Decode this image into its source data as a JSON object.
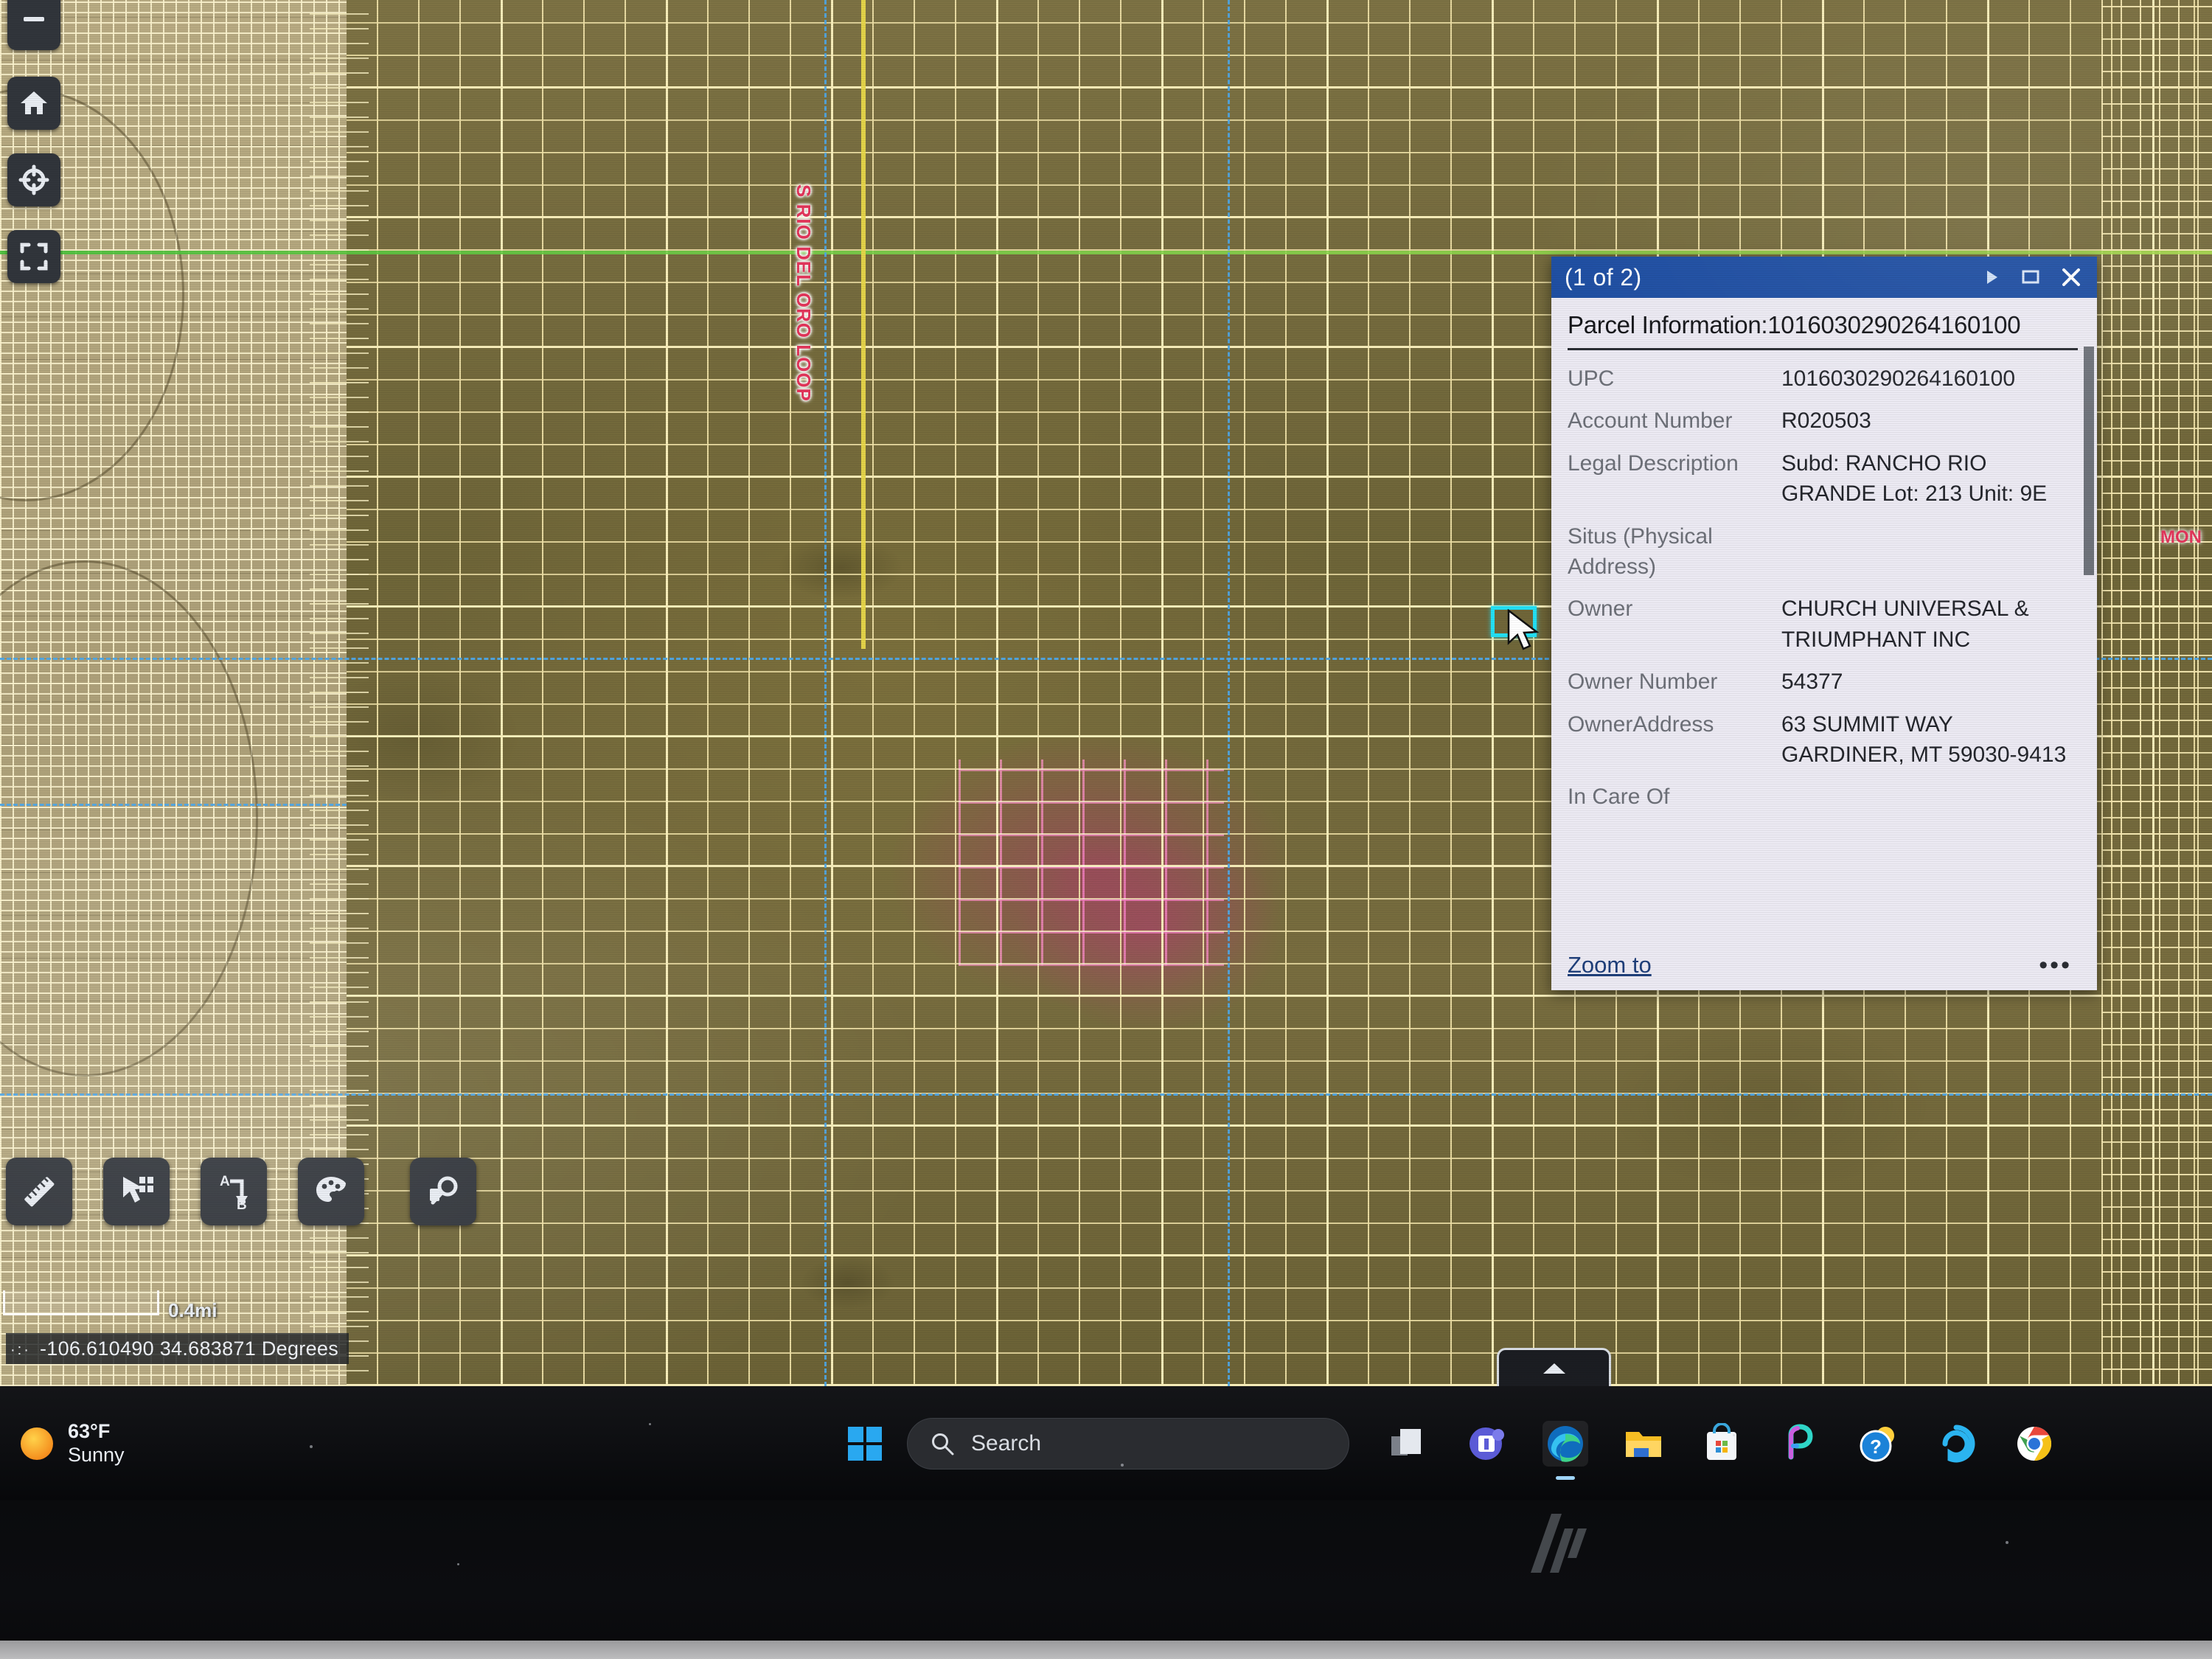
{
  "map": {
    "street_labels": [
      {
        "text": "S RIO DEL ORO LOOP",
        "color": "#e2355a"
      },
      {
        "text": "MON",
        "color": "#e2355a"
      }
    ],
    "scale_label": "0.4mi",
    "coordinates": "-106.610490 34.683871 Degrees",
    "coord_prefix": "·:·",
    "selection_color": "#23e0f5",
    "parcel_line_color": "#f5e8b6",
    "highlight_color": "#e244a0",
    "boundary_green": "#46c23a",
    "boundary_blue": "#4fa8e8"
  },
  "map_toolbar_top": [
    {
      "name": "zoom-out",
      "label": "Zoom out"
    },
    {
      "name": "home",
      "label": "Default extent"
    },
    {
      "name": "locate",
      "label": "My location"
    },
    {
      "name": "fullscreen",
      "label": "Full screen"
    }
  ],
  "map_toolbar_bottom": [
    {
      "name": "measure",
      "label": "Measure"
    },
    {
      "name": "select",
      "label": "Select"
    },
    {
      "name": "directions",
      "label": "Directions"
    },
    {
      "name": "layers",
      "label": "Basemap gallery"
    },
    {
      "name": "find-parcel",
      "label": "Search features"
    }
  ],
  "directions_icon": {
    "from": "A",
    "to": "B"
  },
  "popup": {
    "title": "(1 of 2)",
    "heading": "Parcel Information:1016030290264160100",
    "fields": [
      {
        "label": "UPC",
        "value": "1016030290264160100"
      },
      {
        "label": "Account Number",
        "value": "R020503"
      },
      {
        "label": "Legal Description",
        "value": "Subd: RANCHO RIO GRANDE Lot: 213 Unit: 9E"
      },
      {
        "label": "Situs (Physical Address)",
        "value": ""
      },
      {
        "label": "Owner",
        "value": "CHURCH UNIVERSAL & TRIUMPHANT INC"
      },
      {
        "label": "Owner Number",
        "value": "54377"
      },
      {
        "label": "OwnerAddress",
        "value": "63 SUMMIT WAY GARDINER, MT 59030-9413"
      },
      {
        "label": "In Care Of",
        "value": ""
      }
    ],
    "zoom_to_label": "Zoom to",
    "more_label": "•••",
    "title_buttons": [
      {
        "name": "next",
        "glyph": "next-arrow-icon"
      },
      {
        "name": "maximize",
        "glyph": "maximize-icon"
      },
      {
        "name": "close",
        "glyph": "close-icon"
      }
    ],
    "title_bar_color": "#1f4fa3",
    "background_color": "#eceaf3"
  },
  "taskbar": {
    "weather": {
      "temperature": "63°F",
      "condition": "Sunny",
      "icon": "sun-icon"
    },
    "search": {
      "placeholder": "Search",
      "icon": "search-icon"
    },
    "start": {
      "name": "start-button",
      "label": "Start"
    },
    "apps": [
      {
        "name": "task-view",
        "label": "Task View",
        "active": false
      },
      {
        "name": "teams",
        "label": "Microsoft Teams",
        "active": false
      },
      {
        "name": "edge",
        "label": "Microsoft Edge",
        "active": true
      },
      {
        "name": "file-explorer",
        "label": "File Explorer",
        "active": false
      },
      {
        "name": "microsoft-store",
        "label": "Microsoft Store",
        "active": false
      },
      {
        "name": "copilot",
        "label": "Copilot",
        "active": false
      },
      {
        "name": "get-help",
        "label": "Get Help",
        "active": false
      },
      {
        "name": "alexa",
        "label": "Alexa",
        "active": false
      },
      {
        "name": "chrome",
        "label": "Google Chrome",
        "active": false
      }
    ]
  },
  "monitor": {
    "brand": "hp"
  }
}
